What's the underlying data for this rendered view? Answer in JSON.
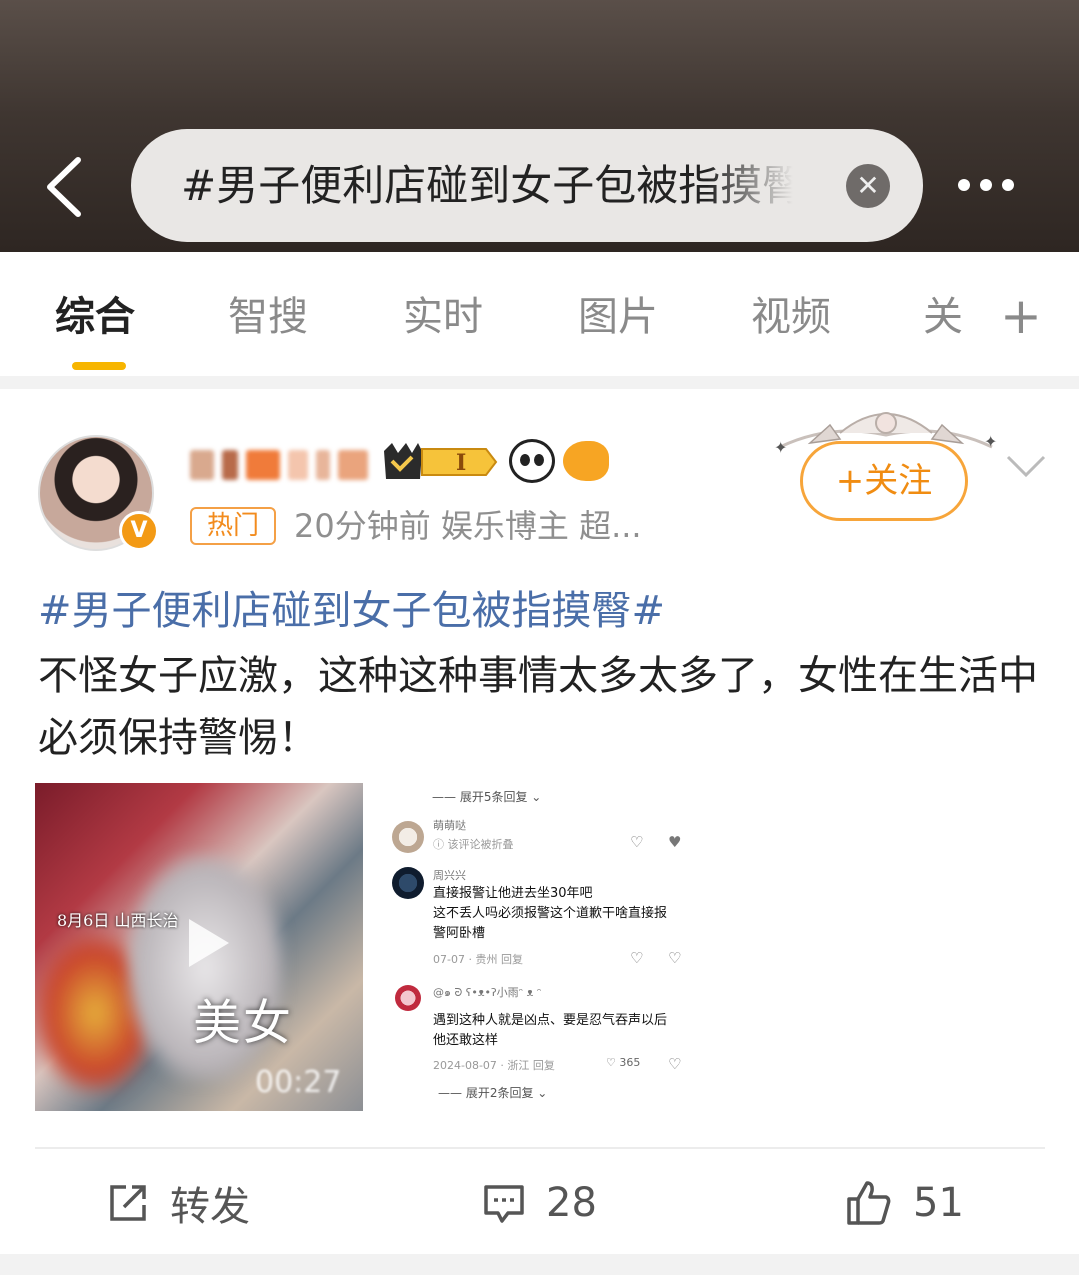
{
  "search": {
    "query": "#男子便利店碰到女子包被指摸臀#"
  },
  "tabs": [
    {
      "label": "综合"
    },
    {
      "label": "智搜"
    },
    {
      "label": "实时"
    },
    {
      "label": "图片"
    },
    {
      "label": "视频"
    },
    {
      "label": "关"
    }
  ],
  "post": {
    "hot_tag": "热门",
    "meta": "20分钟前  娱乐博主 超...",
    "level": "I",
    "follow_label": "+关注",
    "topic": "#男子便利店碰到女子包被指摸臀#",
    "text": "不怪女子应激，这种这种事情太多太多了，女性在生活中必须保持警惕！",
    "video": {
      "date_overlay": "8月6日 山西长治",
      "caption": "美女",
      "duration": "00:27"
    },
    "comments_image": {
      "expand_top": "展开5条回复",
      "expand_bottom": "展开2条回复",
      "comments": [
        {
          "name": "萌萌哒",
          "body": "该评论被折叠",
          "sub": ""
        },
        {
          "name": "周兴兴",
          "body_lines": [
            "直接报警让他进去坐30年吧",
            "这不丢人吗必须报警这个道歉干啥直接报",
            "警阿卧槽"
          ],
          "sub": "07-07 · 贵州    回复"
        },
        {
          "name": "@๑ ᘒ ʕ•ᴥ•ʔ小雨ᵔ ᴥ ᵔ",
          "body_lines": [
            "遇到这种人就是凶点、要是忍气吞声以后",
            "他还敢这样"
          ],
          "sub": "2024-08-07 · 浙江    回复",
          "likes": "365"
        }
      ]
    },
    "actions": {
      "repost": "转发",
      "comments": "28",
      "likes": "51"
    }
  },
  "colors": {
    "accent": "#f7b500",
    "follow": "#f08c12",
    "topic_link": "#4a6ea8"
  }
}
